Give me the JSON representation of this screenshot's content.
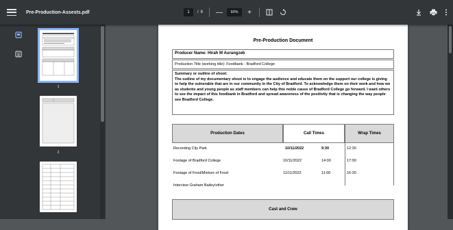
{
  "toolbar": {
    "title": "Pre-Production-Assests.pdf",
    "page_current": "1",
    "page_sep": "/",
    "page_total": "6",
    "zoom_minus": "—",
    "zoom_value": "93%",
    "zoom_plus": "+"
  },
  "sidebar": {
    "thumbs": [
      {
        "label": "1"
      },
      {
        "label": "2"
      }
    ]
  },
  "document": {
    "title": "Pre-Production Document",
    "producer": "Producer Name: Hirah M Aurangzeb",
    "production_title": "Production Title (working title): Foodbank - Bradford College",
    "summary_label": "Summary or outline of shoot:",
    "summary_text": "The outline of my documentary shoot is to engage the audience and educate them on the support our college is giving to help the vulnerable that are in our community in the City of Bradford. To acknowledge them on their work and how we as students and young people as staff members can help this noble cause of Bradford College go forward. I want others to see the impact of this foodbank in Bradford and spread awareness of the positivity that is changing the way people see Bradford College.",
    "dates_table": {
      "headers": [
        "Production Dates",
        "Call Times",
        "Wrap Times"
      ],
      "rows": [
        {
          "item": "Recording City Park",
          "date": "10/11/2022",
          "call": "9:30",
          "wrap": "12:30"
        },
        {
          "item": "Footage of Bradford College",
          "date": "10/11/2022",
          "call": "14:00",
          "wrap": "17:00"
        },
        {
          "item": "Footage of Food/Mixture of Food",
          "date": "11/11/2022",
          "call": "11:00",
          "wrap": "16:30"
        },
        {
          "item": "Interview Graham Bailey/other",
          "date": "",
          "call": "",
          "wrap": ""
        }
      ]
    },
    "crew_header": "Cast and Crew"
  }
}
